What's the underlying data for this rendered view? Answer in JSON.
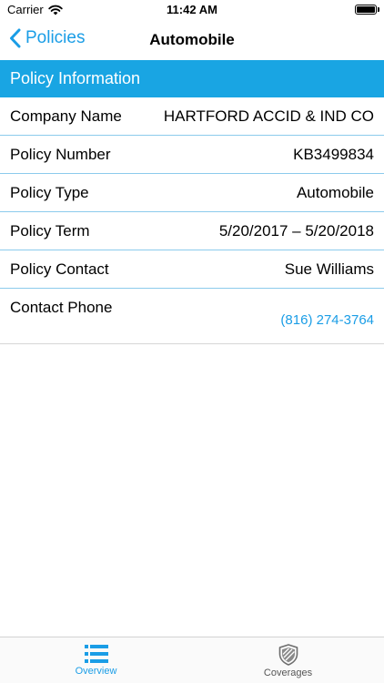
{
  "status_bar": {
    "carrier": "Carrier",
    "time": "11:42 AM",
    "battery_level": 1.0
  },
  "nav": {
    "back_label": "Policies",
    "title": "Automobile"
  },
  "section": {
    "title": "Policy Information"
  },
  "rows": [
    {
      "label": "Company Name",
      "value": "HARTFORD ACCID & IND CO"
    },
    {
      "label": "Policy Number",
      "value": "KB3499834"
    },
    {
      "label": "Policy Type",
      "value": "Automobile"
    },
    {
      "label": "Policy Term",
      "value": "5/20/2017 – 5/20/2018"
    },
    {
      "label": "Policy Contact",
      "value": "Sue Williams"
    },
    {
      "label": "Contact Phone",
      "value": "(816) 274-3764"
    }
  ],
  "tabs": [
    {
      "label": "Overview",
      "icon": "list-icon",
      "selected": true
    },
    {
      "label": "Coverages",
      "icon": "shield-icon",
      "selected": false
    }
  ],
  "colors": {
    "accent": "#1a9de6",
    "section_header": "#19a5e3",
    "row_divider": "#8ccbec"
  }
}
